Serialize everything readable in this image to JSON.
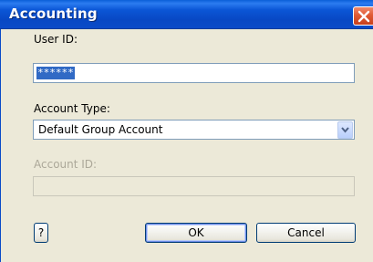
{
  "window": {
    "title": "Accounting",
    "close_icon": "close-icon"
  },
  "form": {
    "user_id_label": "User ID:",
    "user_id_value": "******",
    "account_type_label": "Account Type:",
    "account_type_value": "Default Group Account",
    "account_id_label": "Account ID:",
    "account_id_value": ""
  },
  "buttons": {
    "help_label": "?",
    "ok_label": "OK",
    "cancel_label": "Cancel"
  },
  "colors": {
    "titlebar": "#0a4bc8",
    "dialog_bg": "#ece9d8",
    "selection": "#316ac5",
    "close_button": "#e05a34"
  }
}
